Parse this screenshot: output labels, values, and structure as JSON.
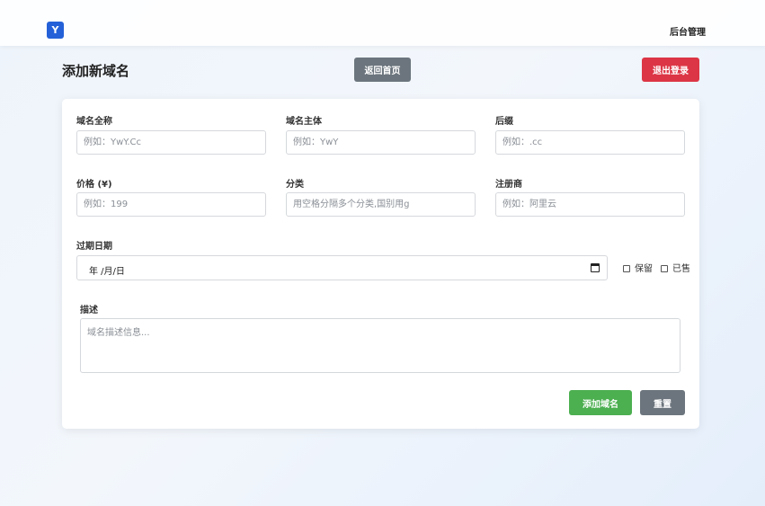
{
  "navbar": {
    "logo_letter": "Y",
    "admin_link": "后台管理"
  },
  "header": {
    "title": "添加新域名",
    "home_button": "返回首页",
    "logout_button": "退出登录"
  },
  "form": {
    "fields": [
      {
        "label": "域名全称",
        "placeholder": "例如：YwY.Cc"
      },
      {
        "label": "域名主体",
        "placeholder": "例如：YwY"
      },
      {
        "label": "后缀",
        "placeholder": "例如：.cc"
      },
      {
        "label": "价格 (¥)",
        "placeholder": "例如：199"
      },
      {
        "label": "分类",
        "placeholder": "用空格分隔多个分类,国别用g"
      },
      {
        "label": "注册商",
        "placeholder": "例如：阿里云"
      }
    ],
    "expiry": {
      "label": "过期日期",
      "value": "年 /月/日"
    },
    "checkboxes": [
      {
        "label": "保留",
        "checked": false
      },
      {
        "label": "已售",
        "checked": false
      }
    ],
    "description": {
      "label": "描述",
      "placeholder": "域名描述信息..."
    },
    "submit_button": "添加域名",
    "reset_button": "重置"
  },
  "colors": {
    "logo": "#2461d8",
    "logout": "#dc3545",
    "submit": "#4caf50",
    "secondary": "#6c757d"
  },
  "icons": {
    "date_picker": "calendar-icon"
  }
}
